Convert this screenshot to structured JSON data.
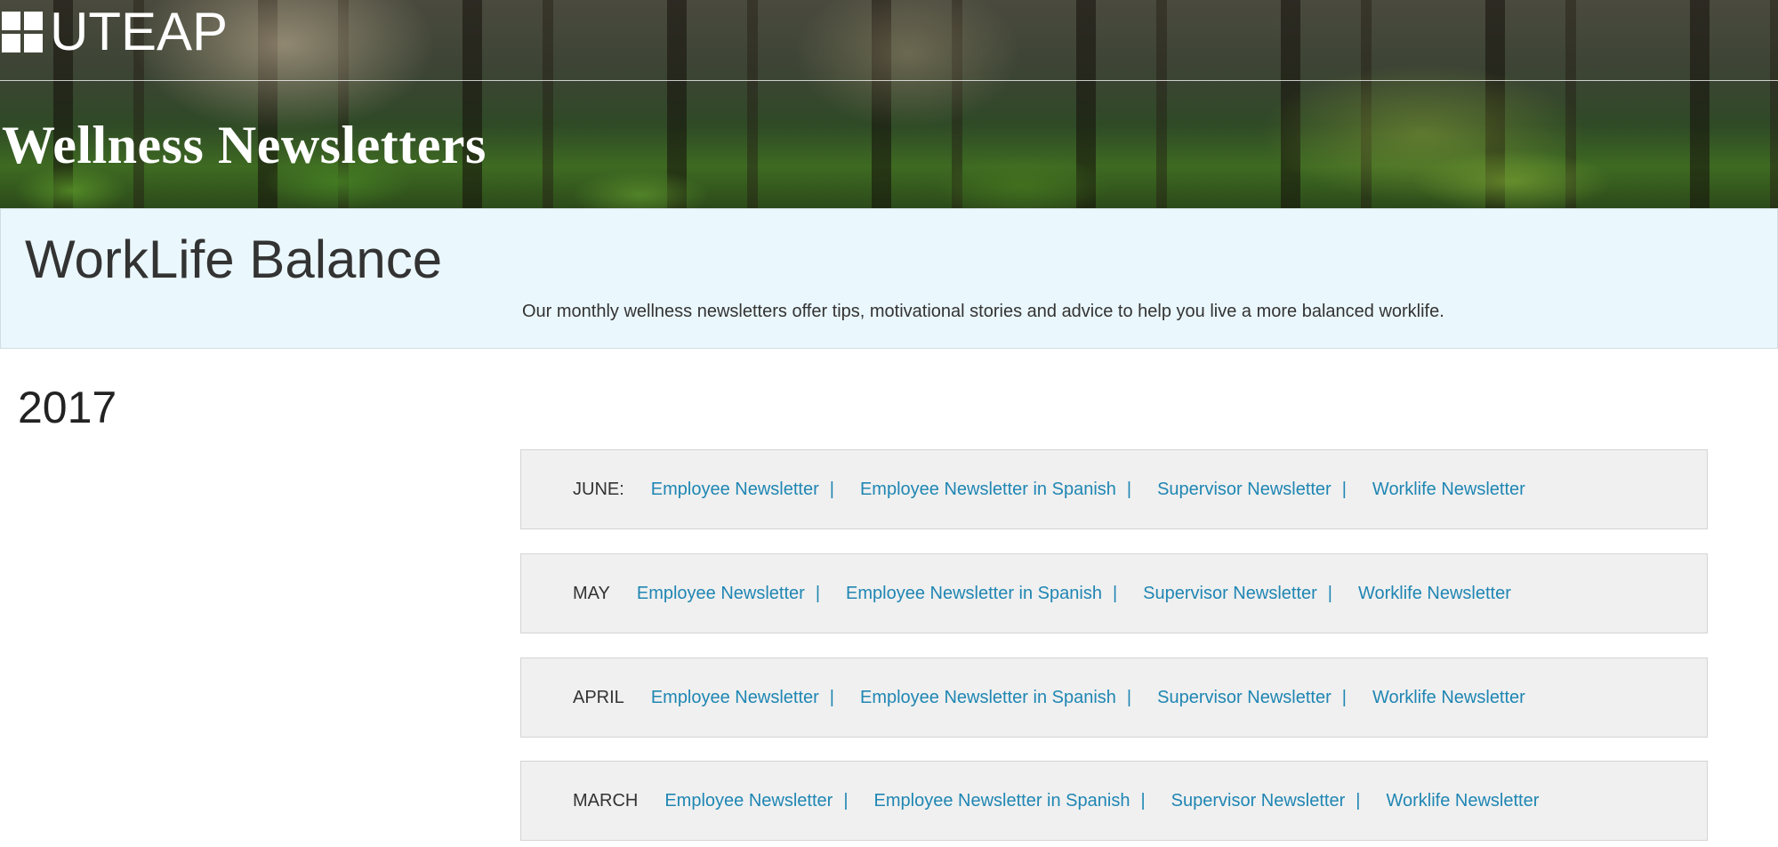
{
  "header": {
    "logo_text": "UTEAP",
    "title": "Wellness Newsletters"
  },
  "intro": {
    "title": "WorkLife Balance",
    "description": "Our monthly wellness newsletters offer tips, motivational stories and advice to help you live a more balanced worklife."
  },
  "year": "2017",
  "separator": "|",
  "rows": [
    {
      "month": "JUNE:",
      "links": [
        "Employee Newsletter",
        "Employee Newsletter in Spanish",
        "Supervisor Newsletter",
        "Worklife Newsletter"
      ]
    },
    {
      "month": "MAY",
      "links": [
        "Employee Newsletter",
        "Employee Newsletter in Spanish",
        "Supervisor Newsletter",
        "Worklife Newsletter"
      ]
    },
    {
      "month": "APRIL",
      "links": [
        "Employee Newsletter",
        "Employee Newsletter in Spanish",
        "Supervisor Newsletter",
        "Worklife Newsletter"
      ]
    },
    {
      "month": "MARCH",
      "links": [
        "Employee Newsletter",
        "Employee Newsletter in Spanish",
        "Supervisor Newsletter",
        "Worklife Newsletter"
      ]
    }
  ],
  "colors": {
    "link": "#1f86b3",
    "intro_background": "#eaf7fc",
    "row_background": "#f0f0f0"
  }
}
